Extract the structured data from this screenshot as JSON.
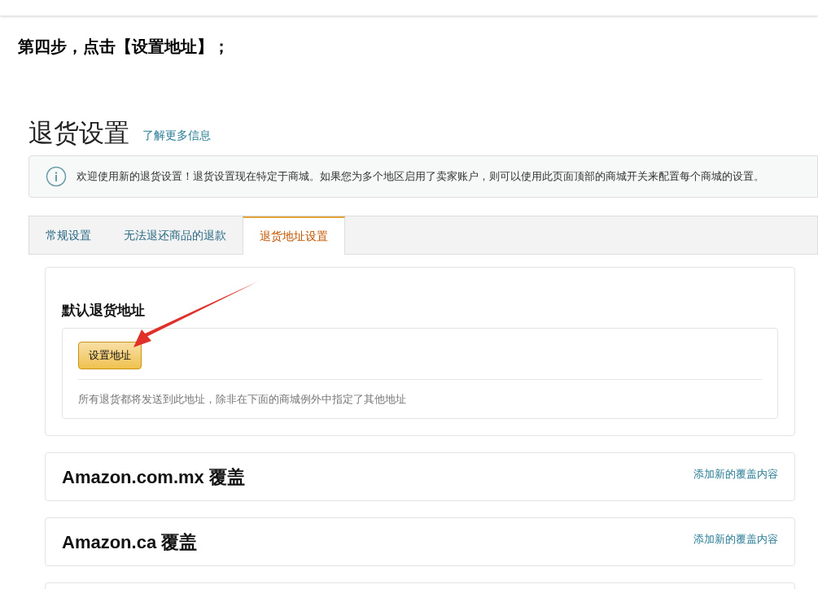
{
  "article": {
    "step_text": "第四步，点击【设置地址】；"
  },
  "page": {
    "title": "退货设置",
    "learn_more_link": "了解更多信息",
    "info_banner": "欢迎使用新的退货设置！退货设置现在特定于商城。如果您为多个地区启用了卖家账户，则可以使用此页面顶部的商城开关来配置每个商城的设置。",
    "tabs": [
      {
        "label": "常规设置",
        "selected": false
      },
      {
        "label": "无法退还商品的退款",
        "selected": false
      },
      {
        "label": "退货地址设置",
        "selected": true
      }
    ],
    "default_address": {
      "heading": "默认退货地址",
      "button": "设置地址",
      "note": "所有退货都将发送到此地址，除非在下面的商城例外中指定了其他地址"
    },
    "overrides": [
      {
        "title": "Amazon.com.mx 覆盖",
        "link": "添加新的覆盖内容"
      },
      {
        "title": "Amazon.ca 覆盖",
        "link": "添加新的覆盖内容"
      }
    ]
  }
}
